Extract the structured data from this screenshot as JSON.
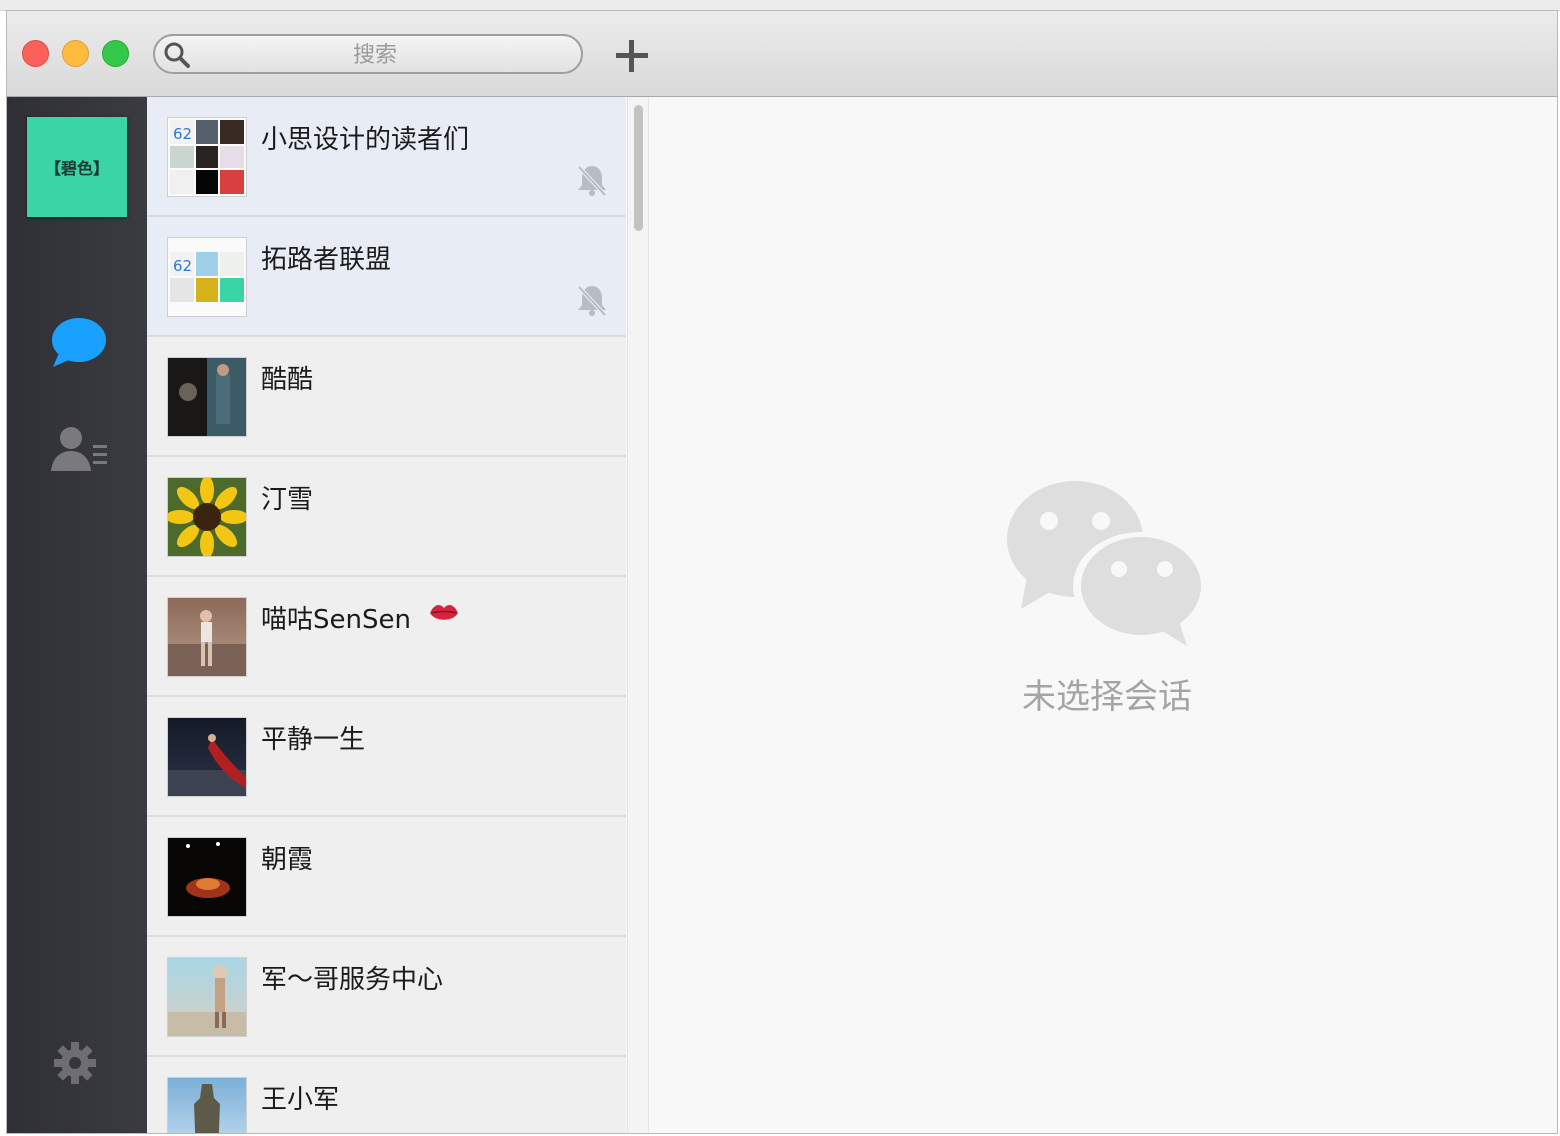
{
  "search": {
    "placeholder": "搜索"
  },
  "sidebar": {
    "profile_text": "【碧色】"
  },
  "conversations": [
    {
      "name": "小思设计的读者们",
      "muted": true,
      "pinned": true
    },
    {
      "name": "拓路者联盟",
      "muted": true,
      "pinned": true
    },
    {
      "name": "酷酷"
    },
    {
      "name": "汀雪"
    },
    {
      "name": "喵咕SenSen",
      "emoji": "lips"
    },
    {
      "name": "平静一生"
    },
    {
      "name": "朝霞"
    },
    {
      "name": "军～哥服务中心"
    },
    {
      "name": "王小军"
    }
  ],
  "main": {
    "empty_text": "未选择会话"
  },
  "colors": {
    "accent": "#1aa1ff",
    "sidebar": "#333438",
    "profile_bg": "#3bd4a6",
    "pinned_bg": "#e8edf5"
  }
}
